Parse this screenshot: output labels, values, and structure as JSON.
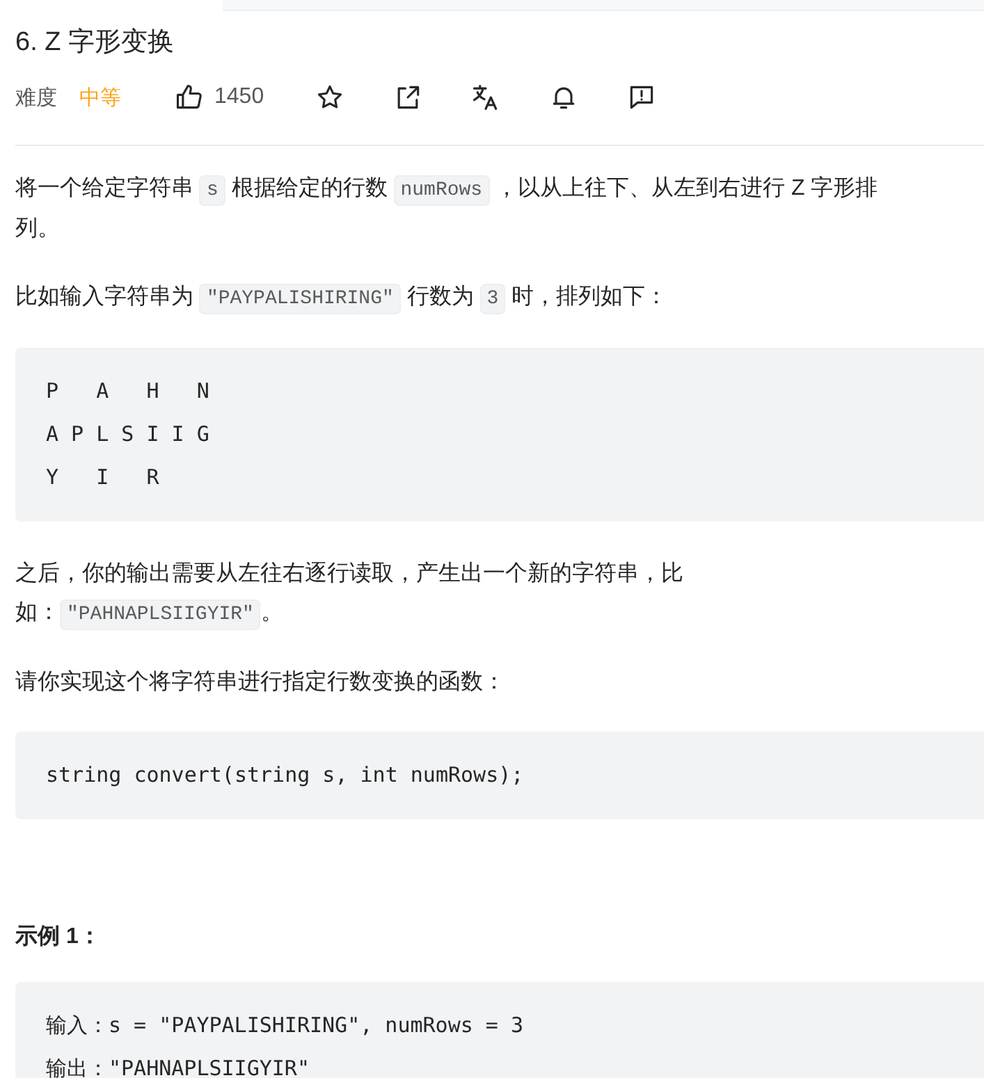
{
  "title": "6. Z 字形变换",
  "meta": {
    "difficulty_label": "难度",
    "difficulty": "中等",
    "likes": "1450"
  },
  "content": [
    {
      "kind": "paragraph",
      "segments": [
        {
          "kind": "text",
          "text": "将一个给定字符串 "
        },
        {
          "kind": "code",
          "text": "s"
        },
        {
          "kind": "text",
          "text": " 根据给定的行数 "
        },
        {
          "kind": "code",
          "text": "numRows"
        },
        {
          "kind": "text",
          "text": " ，以从上往下、从左到右进行 Z 字形排列。"
        }
      ]
    },
    {
      "kind": "paragraph",
      "segments": [
        {
          "kind": "text",
          "text": "比如输入字符串为 "
        },
        {
          "kind": "code",
          "text": "\"PAYPALISHIRING\""
        },
        {
          "kind": "text",
          "text": " 行数为 "
        },
        {
          "kind": "code",
          "text": "3"
        },
        {
          "kind": "text",
          "text": " 时，排列如下："
        }
      ]
    },
    {
      "kind": "codeblock",
      "lines": [
        "P   A   H   N",
        "A P L S I I G",
        "Y   I   R"
      ]
    },
    {
      "kind": "paragraph",
      "segments": [
        {
          "kind": "text",
          "text": "之后，你的输出需要从左往右逐行读取，产生出一个新的字符串，比如："
        },
        {
          "kind": "code",
          "text": "\"PAHNAPLSIIGYIR\""
        },
        {
          "kind": "text",
          "text": "。"
        }
      ]
    },
    {
      "kind": "paragraph",
      "segments": [
        {
          "kind": "text",
          "text": "请你实现这个将字符串进行指定行数变换的函数："
        }
      ]
    },
    {
      "kind": "codeblock",
      "lines": [
        "string convert(string s, int numRows);"
      ]
    },
    {
      "kind": "heading",
      "text": "示例 1："
    },
    {
      "kind": "codeblock",
      "lines": [
        "输入：s = \"PAYPALISHIRING\", numRows = 3",
        "输出：\"PAHNAPLSIIGYIR\""
      ]
    }
  ]
}
